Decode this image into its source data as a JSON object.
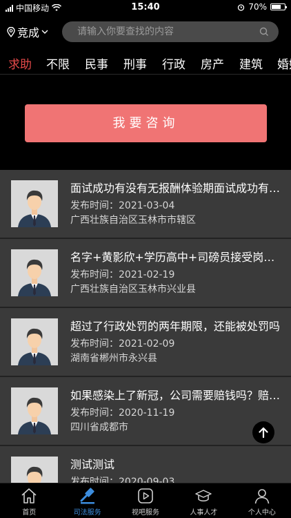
{
  "status_bar": {
    "carrier": "中国移动",
    "time": "15:40",
    "battery_percent": "70%",
    "battery_level": 0.7
  },
  "header": {
    "location": "竞成",
    "search_placeholder": "请输入你要查找的内容"
  },
  "tabs": [
    "求助",
    "不限",
    "民事",
    "刑事",
    "行政",
    "房产",
    "建筑",
    "婚姻"
  ],
  "active_tab": 0,
  "consult_button": "我要咨询",
  "posts": [
    {
      "title": "面试成功有没有无报酬体验期面试成功有没有无报酬体验期",
      "date": "发布时间：2021-03-04",
      "region": "广西壮族自治区玉林市市辖区"
    },
    {
      "title": "名字+黄影欣+学历高中+司磅员接受岗位调岗",
      "date": "发布时间：2021-02-19",
      "region": "广西壮族自治区玉林市兴业县"
    },
    {
      "title": "超过了行政处罚的两年期限，还能被处罚吗",
      "date": "发布时间：2021-02-09",
      "region": "湖南省郴州市永兴县"
    },
    {
      "title": "如果感染上了新冠，公司需要赔钱吗？赔多少",
      "date": "发布时间：2020-11-19",
      "region": "四川省成都市"
    },
    {
      "title": "测试测试",
      "date": "发布时间：2020-09-03",
      "region": ""
    }
  ],
  "bottom_nav": [
    {
      "label": "首页",
      "icon": "home-icon"
    },
    {
      "label": "司法服务",
      "icon": "gavel-icon"
    },
    {
      "label": "视吧服务",
      "icon": "play-icon"
    },
    {
      "label": "人事人才",
      "icon": "graduation-cap-icon"
    },
    {
      "label": "个人中心",
      "icon": "person-icon"
    }
  ],
  "active_nav": 1,
  "colors": {
    "accent_red": "#e84a4a",
    "button_bg": "#f07474",
    "nav_active": "#3c8dde",
    "list_bg": "#3a3a3a"
  }
}
